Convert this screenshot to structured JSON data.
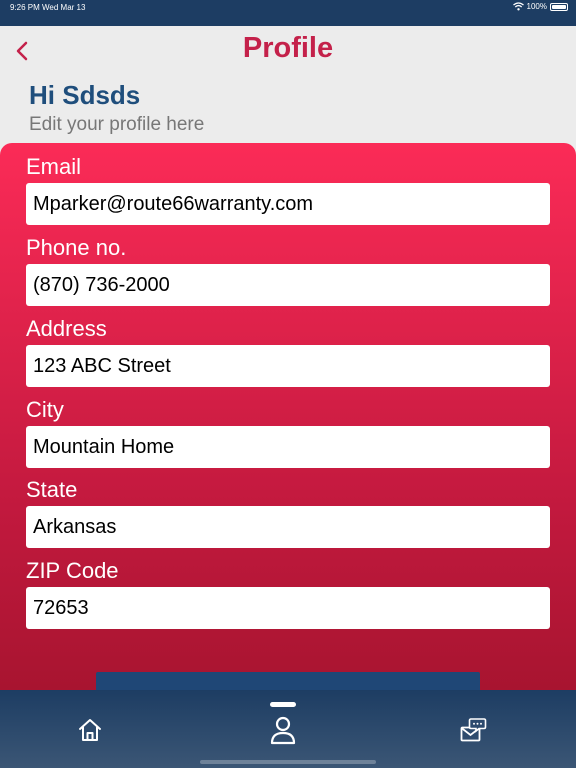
{
  "status_bar": {
    "time": "9:26 PM",
    "date": "Wed Mar 13",
    "battery": "100%"
  },
  "header": {
    "title": "Profile"
  },
  "greeting": "Hi Sdsds",
  "subtitle": "Edit your profile here",
  "form": {
    "email": {
      "label": "Email",
      "value": "Mparker@route66warranty.com"
    },
    "phone": {
      "label": "Phone no.",
      "value": "(870) 736-2000"
    },
    "address": {
      "label": "Address",
      "value": "123 ABC Street"
    },
    "city": {
      "label": "City",
      "value": "Mountain Home"
    },
    "state": {
      "label": "State",
      "value": "Arkansas"
    },
    "zip": {
      "label": "ZIP Code",
      "value": "72653"
    }
  },
  "tab_bar": {
    "tabs": [
      {
        "name": "home",
        "icon": "home-icon"
      },
      {
        "name": "profile",
        "icon": "user-icon",
        "active": true
      },
      {
        "name": "messages",
        "icon": "mail-chat-icon"
      }
    ]
  },
  "colors": {
    "accent": "#c4214a",
    "navy": "#1d3d63",
    "greeting": "#1f4e7c"
  }
}
